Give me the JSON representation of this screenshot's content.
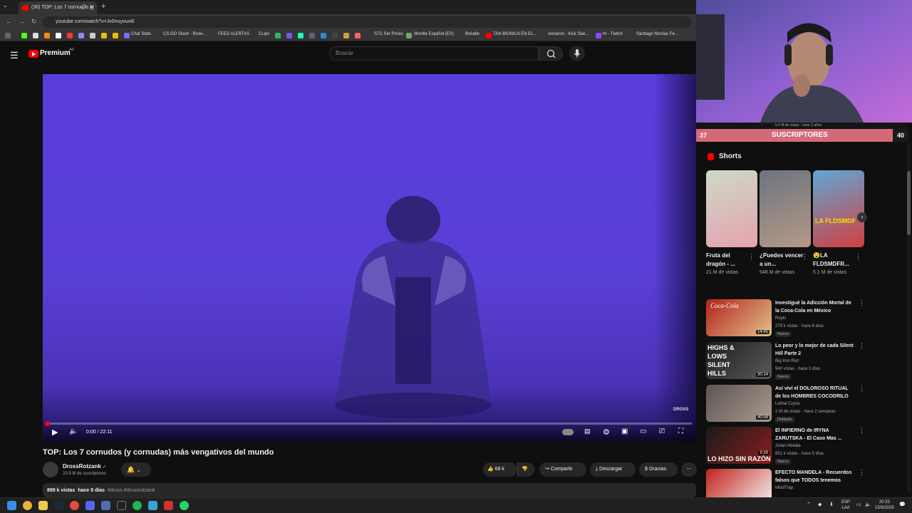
{
  "browser": {
    "tab_title": "(36) TOP: Los 7 cornudos (y",
    "url": "youtube.com/watch?v=Jv0nuyouvi0",
    "new_tab": "+",
    "bookmarks": [
      "Chat Stats",
      "CS:GO Stash - Brow...",
      "FEED ALERTAS",
      "CLips",
      "STC Set Prices",
      "Wordle Español (ES)",
      "Boludle",
      "TAN BIONICA EN EL...",
      "sionaron - Kick Stat...",
      "trr - Twitch",
      "Santiago Nicolas Fe..."
    ]
  },
  "header": {
    "logo_text": "Premium",
    "country": "AR",
    "search_placeholder": "Buscar"
  },
  "player": {
    "time": "0:00 / 22:11",
    "watermark": "DROSS",
    "progress_fraction": 0.0
  },
  "video": {
    "title": "TOP: Los 7 cornudos (y cornudas) más vengativos del mundo",
    "channel": "DrossRotzank",
    "verified": "✓",
    "subscribers": "23.9 M de suscriptores",
    "likes": "68 k",
    "share": "Compartir",
    "download": "Descargar",
    "thanks": "Gracias",
    "views": "899 k vistas",
    "age": "hace 9 días",
    "tags": "#dross #drossrotzank"
  },
  "overlay": {
    "left_count": "37",
    "label": "SUSCRIPTORES",
    "right_count": "40",
    "strip_text": "5.6 M de vistas · hace 2 años"
  },
  "shorts": {
    "title": "Shorts",
    "items": [
      {
        "title": "Fruta del dragón - ...",
        "views": "21 M de vistas",
        "colors": [
          "#c9d6c0",
          "#e8a6b0"
        ]
      },
      {
        "title": "¿Puedes vencer a un...",
        "views": "548 M de vistas",
        "colors": [
          "#6c7480",
          "#b59a86"
        ]
      },
      {
        "title": "😮LA FLDSMDFR...",
        "views": "5.1 M de vistas",
        "overlay_text": "LA FLDSMDF",
        "colors": [
          "#5fa7d6",
          "#d04040"
        ]
      }
    ]
  },
  "recommended": [
    {
      "title": "Investigué la Adicción Mortal de la Coca-Cola en México",
      "channel": "Royki",
      "meta": "279 k vistas · hace 6 días",
      "badge": "Nuevo",
      "duration": "14:45",
      "thumb_text": "Coca-Cola",
      "colors": [
        "#b1231b",
        "#e3c08a"
      ]
    },
    {
      "title": "Lo peor y lo mejor de cada Silent Hill Parte 2",
      "channel": "Big Iron Riot",
      "meta": "940 vistas · hace 3 días",
      "badge": "Nuevo",
      "duration": "30:14",
      "thumb_text": "HIGHS & LOWS SILENT HILLS",
      "colors": [
        "#222",
        "#555"
      ]
    },
    {
      "title": "Así viví el DOLOROSO RITUAL de los HOMBRES COCODRILO",
      "channel": "Lethal Crysis",
      "meta": "1 M de vistas · hace 2 semanas",
      "badge": "Doblado",
      "duration": "40:59",
      "thumb_text": "",
      "colors": [
        "#5d5550",
        "#a89a90"
      ]
    },
    {
      "title": "El INFIERNO de IRYNA ZARUTSKA - El Caso Mas ...",
      "channel": "Julian Abdala",
      "meta": "651 k vistas · hace 5 días",
      "badge": "Nuevo",
      "duration": "9:39",
      "thumb_text": "LO HIZO SIN RAZÓN",
      "colors": [
        "#1a1a1a",
        "#8a1e1e"
      ]
    },
    {
      "title": "EFECTO MANDELA - Recuerdos falsos que TODOS tenemos",
      "channel": "MindTrap",
      "meta": "",
      "badge": "",
      "duration": "",
      "thumb_text": "",
      "colors": [
        "#c2211c",
        "#f4f4f4"
      ]
    }
  ],
  "taskbar": {
    "lang": "ESP\nLAA",
    "time": "20:33",
    "date": "15/9/2025"
  }
}
